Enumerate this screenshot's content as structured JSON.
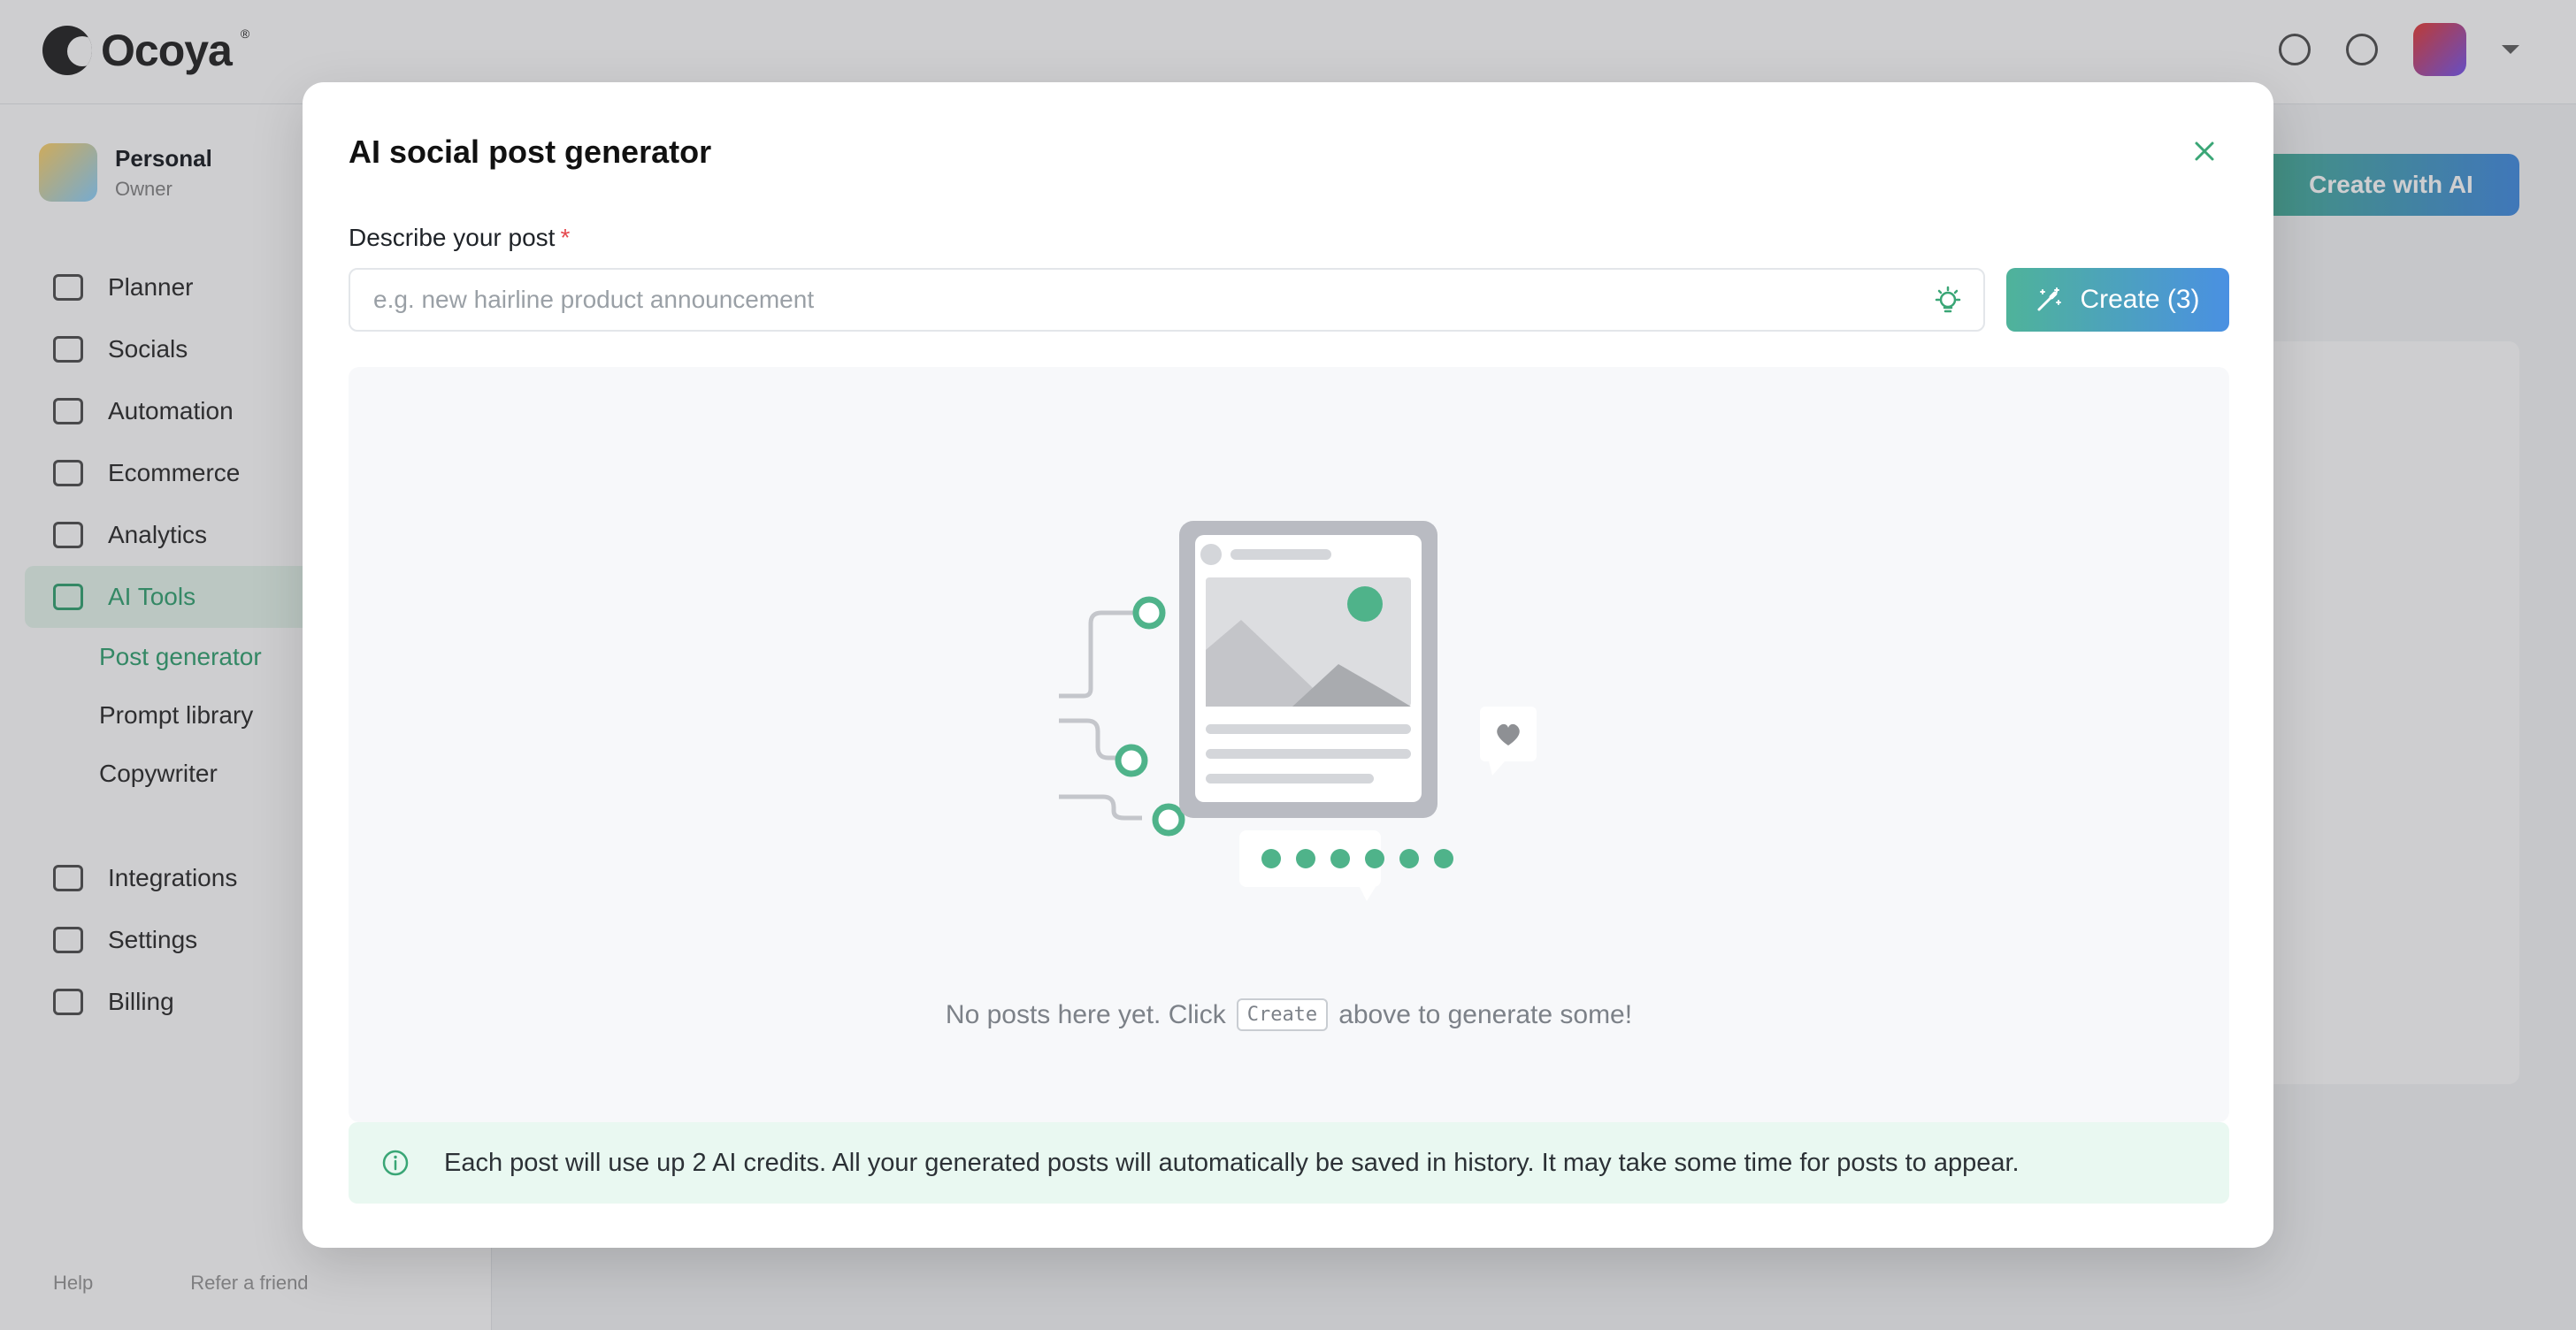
{
  "app": {
    "brand": "Ocoya",
    "brand_mark": "®"
  },
  "sidebar": {
    "workspace": {
      "name": "Personal",
      "role": "Owner"
    },
    "items": [
      {
        "label": "Planner",
        "icon": "calendar-icon"
      },
      {
        "label": "Socials",
        "icon": "socials-icon"
      },
      {
        "label": "Automation",
        "icon": "automation-icon"
      },
      {
        "label": "Ecommerce",
        "icon": "tag-icon"
      },
      {
        "label": "Analytics",
        "icon": "analytics-icon"
      },
      {
        "label": "AI Tools",
        "icon": "ai-tools-icon",
        "active": true
      }
    ],
    "sub_items": [
      {
        "label": "Post generator",
        "icon": "wand-icon",
        "active": true
      },
      {
        "label": "Prompt library",
        "icon": "library-icon"
      },
      {
        "label": "Copywriter",
        "icon": "pen-icon"
      }
    ],
    "bottom_items": [
      {
        "label": "Integrations",
        "icon": "share-icon"
      },
      {
        "label": "Settings",
        "icon": "gear-icon"
      },
      {
        "label": "Billing",
        "icon": "card-icon"
      }
    ],
    "footer": {
      "help": "Help",
      "refer": "Refer a friend"
    }
  },
  "main": {
    "create_ai_label": "Create with AI"
  },
  "modal": {
    "title": "AI social post generator",
    "field_label": "Describe your post",
    "required_mark": "*",
    "input_value": "",
    "input_placeholder": "e.g. new hairline product announcement",
    "create_button": "Create (3)",
    "empty": {
      "prefix": "No posts here yet. Click",
      "kbd": "Create",
      "suffix": "above to generate some!"
    },
    "notice": "Each post will use up 2 AI credits. All your generated posts will automatically be saved in history. It may take some time for posts to appear."
  },
  "colors": {
    "accent": "#4fb39a",
    "accent_blue": "#4a90e2",
    "notice_bg": "#e9f8f1",
    "required": "#e5484d"
  }
}
